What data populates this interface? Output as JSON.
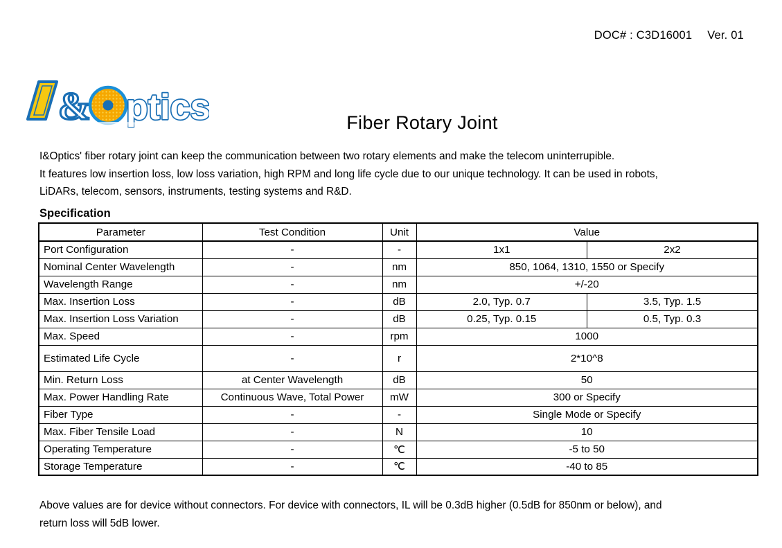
{
  "header": {
    "doc_label": "DOC# : C3D16001",
    "version": "Ver. 01"
  },
  "logo": {
    "brand_text": "I&Optics",
    "colors": {
      "blue": "#1a6fb5",
      "yellow": "#f7c80a",
      "orange": "#f5a300",
      "white": "#ffffff"
    }
  },
  "product": {
    "title": "Fiber Rotary Joint"
  },
  "intro": {
    "line1": "I&Optics' fiber rotary joint can keep the communication between two rotary elements and make the telecom uninterrupible.",
    "line2": "It features low insertion loss, low loss variation, high RPM and long life cycle due to our unique technology. It can be used in robots,",
    "line3": "LiDARs, telecom, sensors, instruments, testing systems and R&D."
  },
  "specification": {
    "heading": "Specification",
    "columns": {
      "parameter": "Parameter",
      "test_condition": "Test Condition",
      "unit": "Unit",
      "value": "Value"
    },
    "rows": [
      {
        "parameter": "Port Configuration",
        "test_condition": "-",
        "unit": "-",
        "split": true,
        "value_a": "1x1",
        "value_b": "2x2",
        "tall": false
      },
      {
        "parameter": "Nominal Center Wavelength",
        "test_condition": "-",
        "unit": "nm",
        "split": false,
        "value": "850, 1064, 1310, 1550 or Specify",
        "tall": false
      },
      {
        "parameter": "Wavelength Range",
        "test_condition": "-",
        "unit": "nm",
        "split": false,
        "value": "+/-20",
        "tall": false
      },
      {
        "parameter": "Max. Insertion Loss",
        "test_condition": "-",
        "unit": "dB",
        "split": true,
        "value_a": "2.0, Typ. 0.7",
        "value_b": "3.5, Typ. 1.5",
        "tall": false
      },
      {
        "parameter": "Max. Insertion Loss Variation",
        "test_condition": "-",
        "unit": "dB",
        "split": true,
        "value_a": "0.25, Typ. 0.15",
        "value_b": "0.5, Typ. 0.3",
        "tall": false
      },
      {
        "parameter": "Max. Speed",
        "test_condition": "-",
        "unit": "rpm",
        "split": false,
        "value": "1000",
        "tall": false
      },
      {
        "parameter": "Estimated Life Cycle",
        "test_condition": "-",
        "unit": "r",
        "split": false,
        "value": "2*10^8",
        "tall": true
      },
      {
        "parameter": "Min. Return Loss",
        "test_condition": "at Center Wavelength",
        "unit": "dB",
        "split": false,
        "value": "50",
        "tall": false
      },
      {
        "parameter": "Max. Power Handling Rate",
        "test_condition": "Continuous Wave, Total Power",
        "unit": "mW",
        "split": false,
        "value": "300 or Specify",
        "tall": false
      },
      {
        "parameter": "Fiber Type",
        "test_condition": "-",
        "unit": "-",
        "split": false,
        "value": "Single Mode or Specify",
        "tall": false
      },
      {
        "parameter": "Max. Fiber Tensile Load",
        "test_condition": "-",
        "unit": "N",
        "split": false,
        "value": "10",
        "tall": false
      },
      {
        "parameter": "Operating Temperature",
        "test_condition": "-",
        "unit": "℃",
        "split": false,
        "value": "-5 to 50",
        "tall": false
      },
      {
        "parameter": "Storage Temperature",
        "test_condition": "-",
        "unit": "℃",
        "split": false,
        "value": "-40 to 85",
        "tall": false
      }
    ]
  },
  "footnote": {
    "line1": "Above values are for device without connectors. For device with connectors, IL will be 0.3dB higher (0.5dB for 850nm or below),  and",
    "line2": "return loss will 5dB lower."
  }
}
